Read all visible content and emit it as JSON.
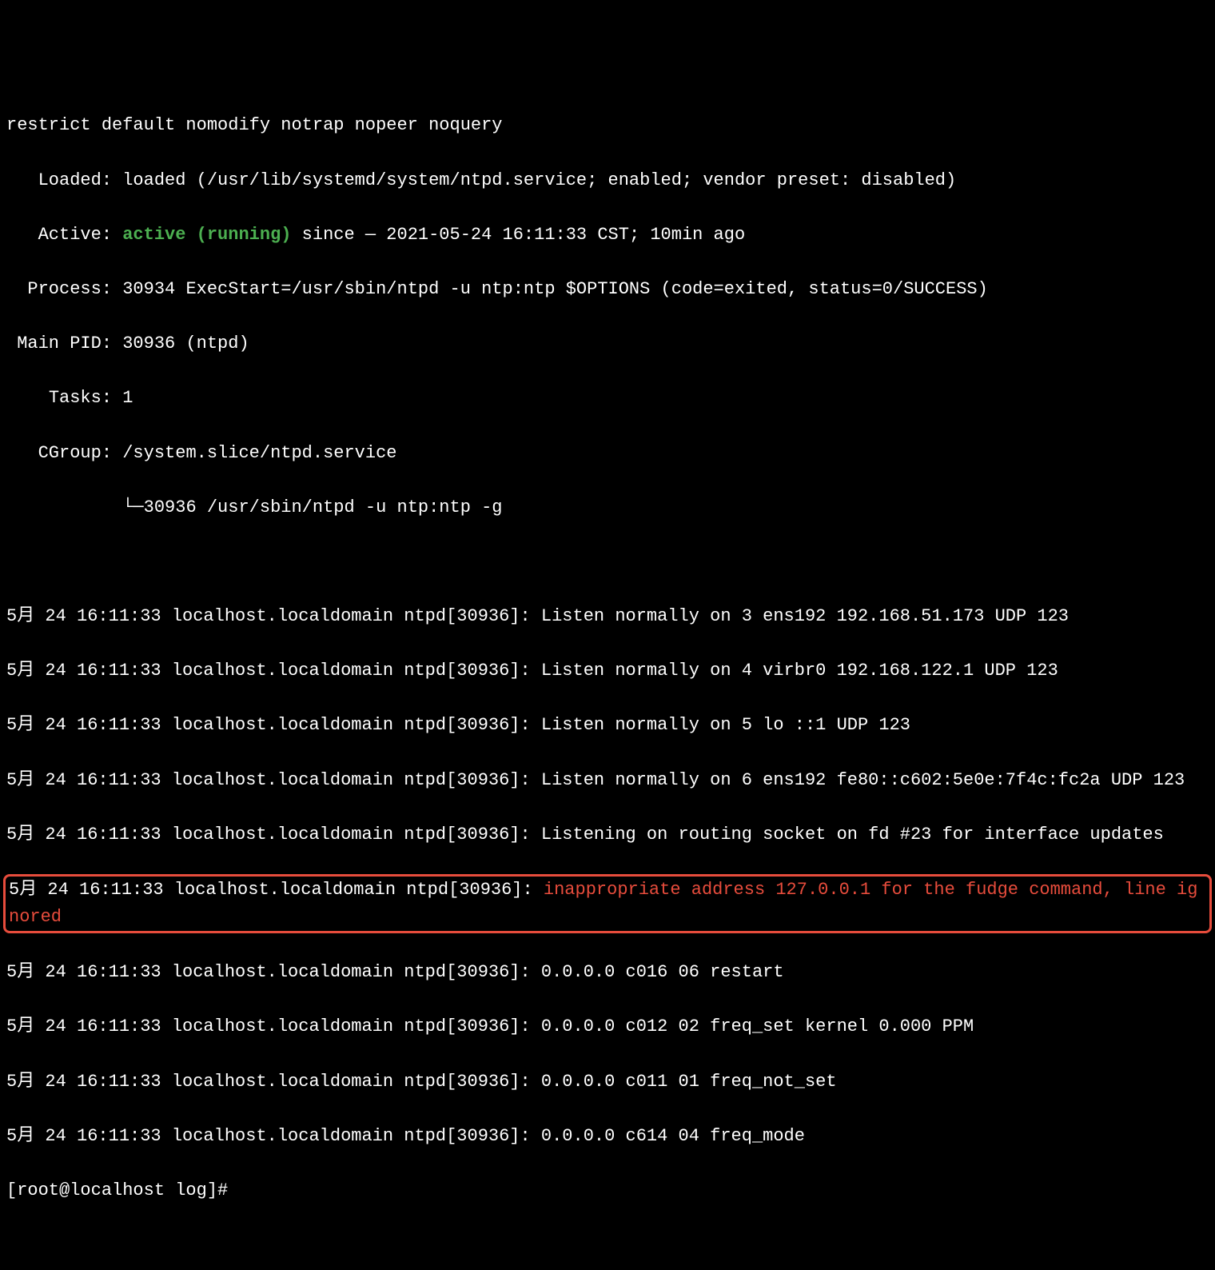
{
  "status": {
    "restrict": "restrict default nomodify notrap nopeer noquery",
    "loaded_label": "   Loaded:",
    "loaded_value": " loaded (/usr/lib/systemd/system/ntpd.service; enabled; vendor preset: disabled)",
    "active_label": "   Active:",
    "active_running": " active (running)",
    "active_since": " since — 2021-05-24 16:11:33 CST; 10min ago",
    "process_label": "  Process:",
    "process_value": " 30934 ExecStart=/usr/sbin/ntpd -u ntp:ntp $OPTIONS (code=exited, status=0/SUCCESS)",
    "mainpid_label": " Main PID:",
    "mainpid_value": " 30936 (ntpd)",
    "tasks_label": "    Tasks:",
    "tasks_value": " 1",
    "cgroup_label": "   CGroup:",
    "cgroup_value": " /system.slice/ntpd.service",
    "cgroup_child": "           └─30936 /usr/sbin/ntpd -u ntp:ntp -g"
  },
  "blank": " ",
  "logs": {
    "l1": "5月 24 16:11:33 localhost.localdomain ntpd[30936]: Listen normally on 3 ens192 192.168.51.173 UDP 123",
    "l2": "5月 24 16:11:33 localhost.localdomain ntpd[30936]: Listen normally on 4 virbr0 192.168.122.1 UDP 123",
    "l3": "5月 24 16:11:33 localhost.localdomain ntpd[30936]: Listen normally on 5 lo ::1 UDP 123",
    "l4": "5月 24 16:11:33 localhost.localdomain ntpd[30936]: Listen normally on 6 ens192 fe80::c602:5e0e:7f4c:fc2a UDP 123",
    "l5": "5月 24 16:11:33 localhost.localdomain ntpd[30936]: Listening on routing socket on fd #23 for interface updates",
    "l6_prefix": "5月 24 16:11:33 localhost.localdomain ntpd[30936]: ",
    "l6_error": "inappropriate address 127.0.0.1 for the fudge command, line ignored",
    "l7": "5月 24 16:11:33 localhost.localdomain ntpd[30936]: 0.0.0.0 c016 06 restart",
    "l8": "5月 24 16:11:33 localhost.localdomain ntpd[30936]: 0.0.0.0 c012 02 freq_set kernel 0.000 PPM",
    "l9": "5月 24 16:11:33 localhost.localdomain ntpd[30936]: 0.0.0.0 c011 01 freq_not_set",
    "l10": "5月 24 16:11:33 localhost.localdomain ntpd[30936]: 0.0.0.0 c614 04 freq_mode"
  },
  "prompt": "[root@localhost log]# "
}
